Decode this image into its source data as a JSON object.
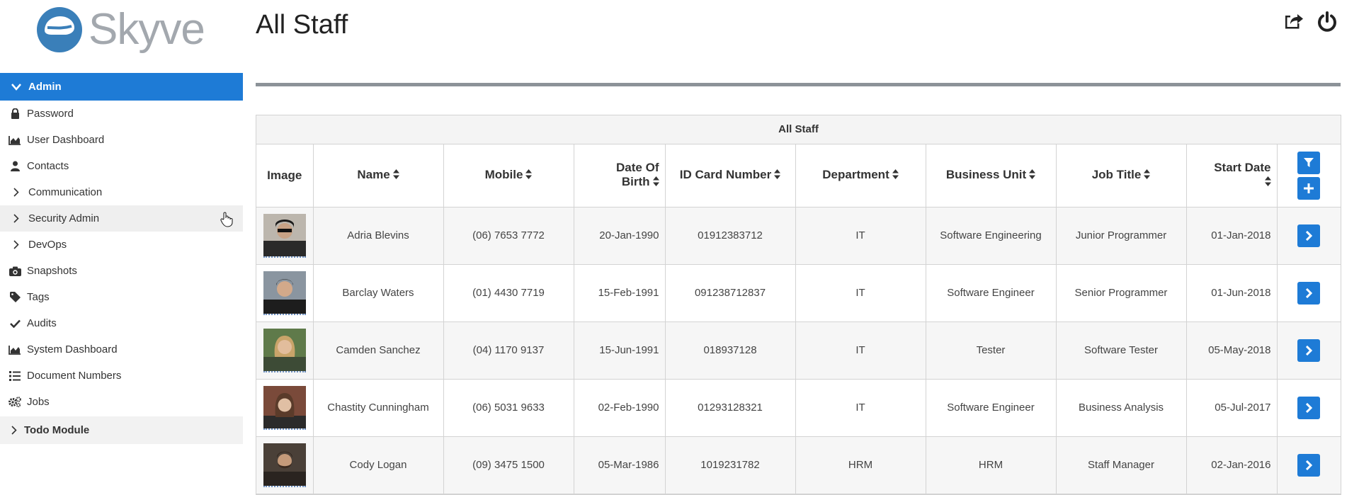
{
  "app": {
    "logo_text": "Skyve"
  },
  "sidebar": {
    "group_admin": "Admin",
    "items": [
      {
        "label": "Password",
        "icon": "lock-icon"
      },
      {
        "label": "User Dashboard",
        "icon": "area-chart-icon"
      },
      {
        "label": "Contacts",
        "icon": "user-icon"
      },
      {
        "label": "Communication",
        "icon": "chevron-right-icon"
      },
      {
        "label": "Security Admin",
        "icon": "chevron-right-icon"
      },
      {
        "label": "DevOps",
        "icon": "chevron-right-icon"
      },
      {
        "label": "Snapshots",
        "icon": "camera-icon"
      },
      {
        "label": "Tags",
        "icon": "tag-icon"
      },
      {
        "label": "Audits",
        "icon": "check-icon"
      },
      {
        "label": "System Dashboard",
        "icon": "area-chart-icon"
      },
      {
        "label": "Document Numbers",
        "icon": "list-icon"
      },
      {
        "label": "Jobs",
        "icon": "gears-icon"
      }
    ],
    "group_todo": "Todo Module"
  },
  "header": {
    "title": "All Staff"
  },
  "grid": {
    "caption": "All Staff",
    "columns": {
      "image": "Image",
      "name": "Name",
      "mobile": "Mobile",
      "dob_1": "Date Of",
      "dob_2": "Birth",
      "id_card": "ID Card Number",
      "department": "Department",
      "business_unit": "Business Unit",
      "job_title": "Job Title",
      "start_date": "Start Date"
    },
    "rows": [
      {
        "name": "Adria Blevins",
        "mobile": "(06) 7653 7772",
        "dob": "20-Jan-1990",
        "id": "01912383712",
        "dept": "IT",
        "bu": "Software Engineering",
        "job": "Junior Programmer",
        "start": "01-Jan-2018"
      },
      {
        "name": "Barclay Waters",
        "mobile": "(01) 4430 7719",
        "dob": "15-Feb-1991",
        "id": "091238712837",
        "dept": "IT",
        "bu": "Software Engineer",
        "job": "Senior Programmer",
        "start": "01-Jun-2018"
      },
      {
        "name": "Camden Sanchez",
        "mobile": "(04) 1170 9137",
        "dob": "15-Jun-1991",
        "id": "018937128",
        "dept": "IT",
        "bu": "Tester",
        "job": "Software Tester",
        "start": "05-May-2018"
      },
      {
        "name": "Chastity Cunningham",
        "mobile": "(06) 5031 9633",
        "dob": "02-Feb-1990",
        "id": "01293128321",
        "dept": "IT",
        "bu": "Software Engineer",
        "job": "Business Analysis",
        "start": "05-Jul-2017"
      },
      {
        "name": "Cody Logan",
        "mobile": "(09) 3475 1500",
        "dob": "05-Mar-1986",
        "id": "1019231782",
        "dept": "HRM",
        "bu": "HRM",
        "job": "Staff Manager",
        "start": "02-Jan-2016"
      }
    ]
  },
  "colors": {
    "accent": "#1e7bd6",
    "logo_grey": "#a3a8ae",
    "logo_blue": "#3a7fb9"
  }
}
